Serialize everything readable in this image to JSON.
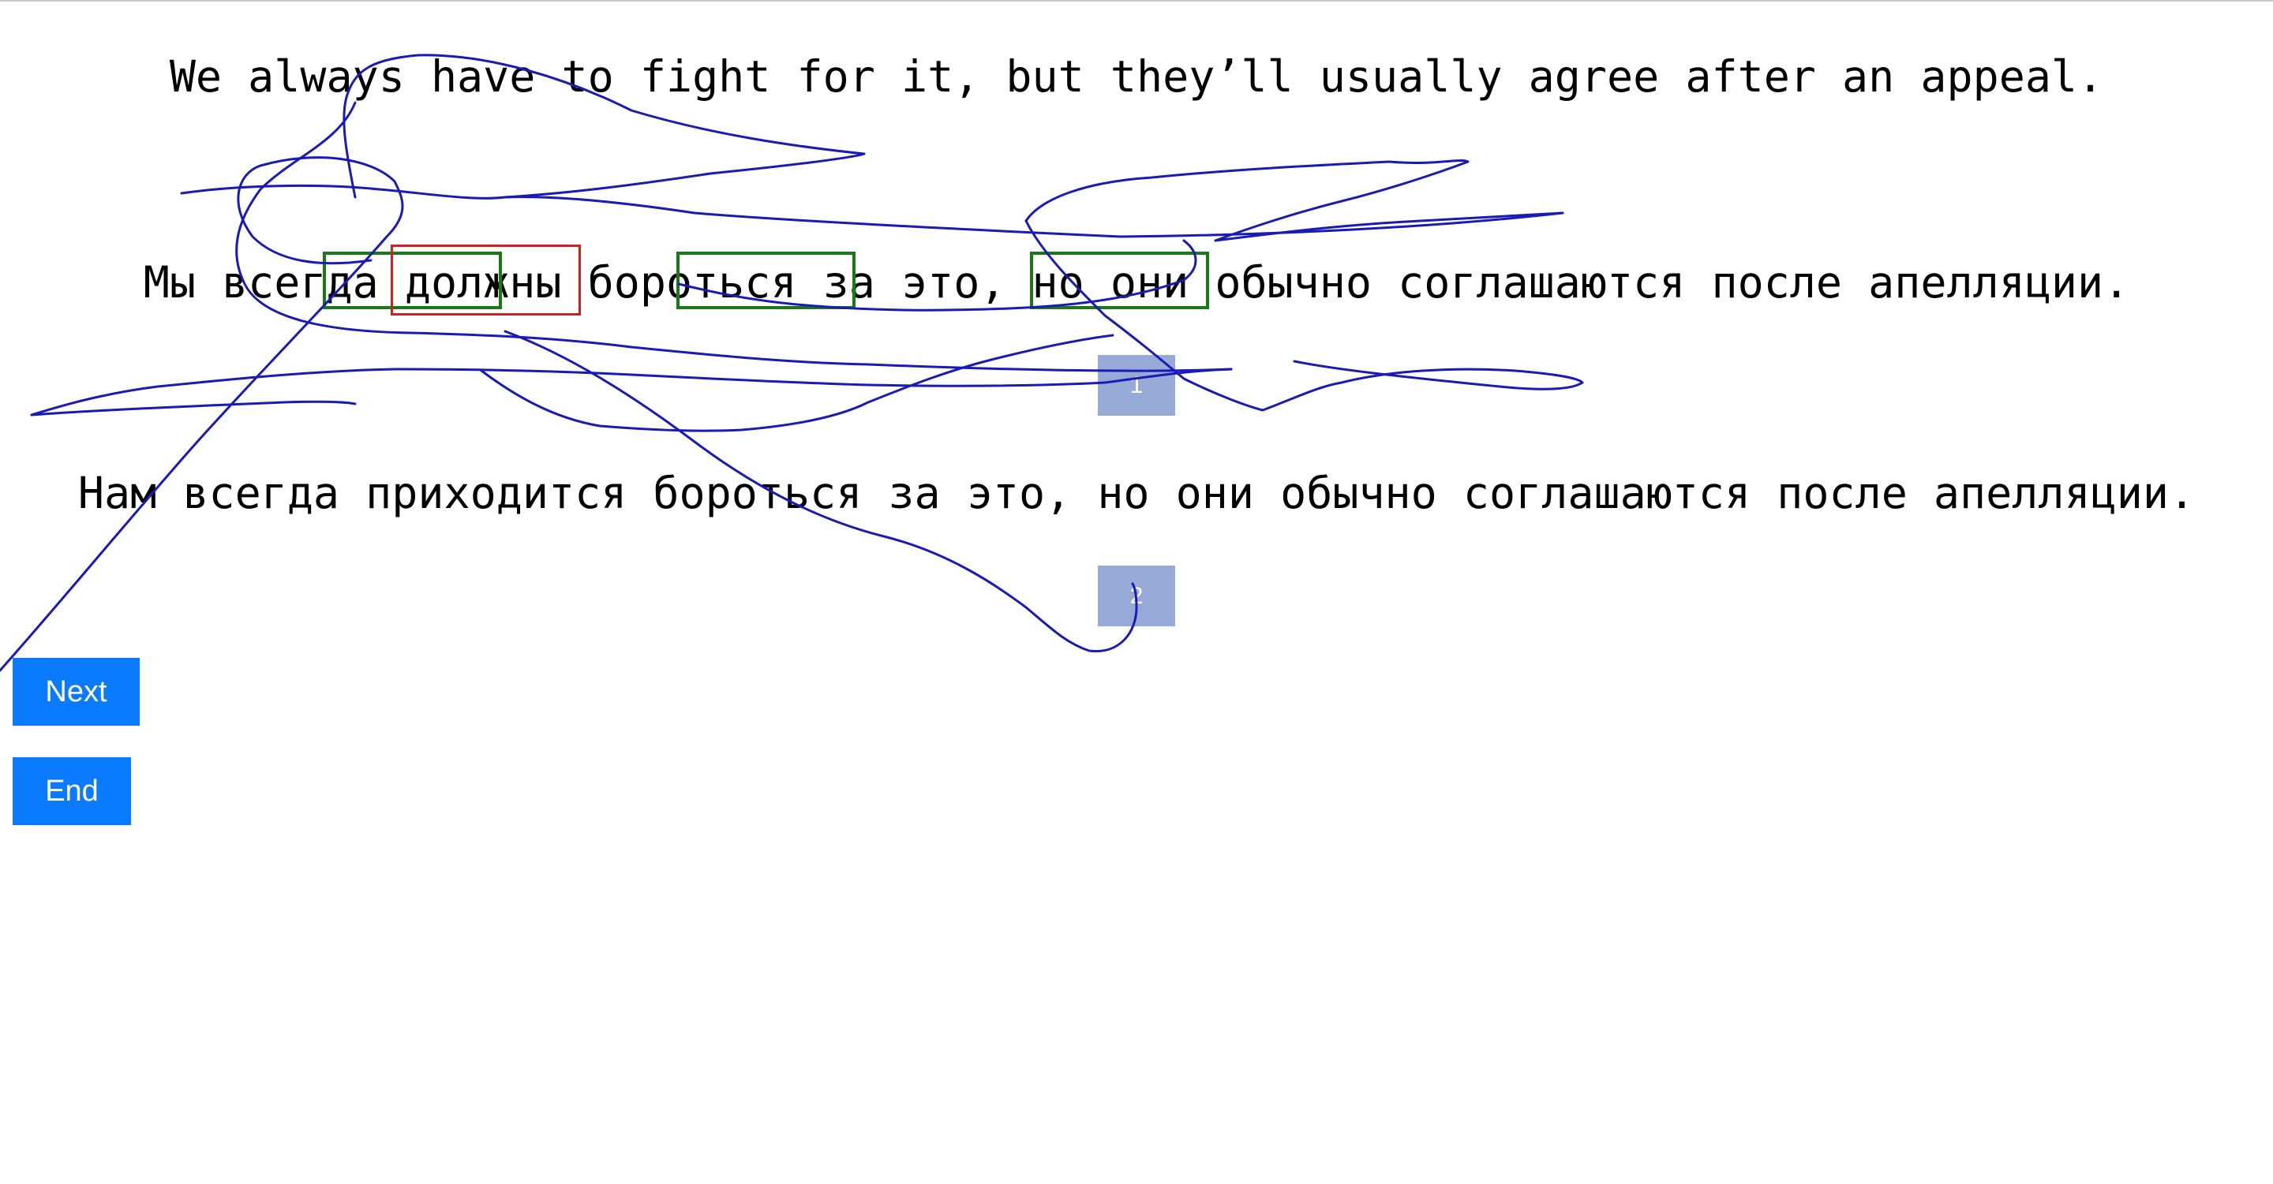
{
  "source_sentence": "We always have to fight for it, but they’ll usually agree after an appeal.",
  "translations": [
    {
      "text": "Мы всегда должны бороться за это, но они обычно соглашаются после апелляции.",
      "label": "1"
    },
    {
      "text": "Нам всегда приходится бороться за это, но они обычно соглашаются после апелляции.",
      "label": "2"
    }
  ],
  "buttons": {
    "next_label": "Next",
    "end_label": "End"
  },
  "colors": {
    "button_blue": "#0a7bff",
    "badge_blue": "#97a9d6",
    "highlight_green": "#177a17",
    "highlight_red": "#d02020",
    "pen_stroke": "#1a1ab8"
  }
}
